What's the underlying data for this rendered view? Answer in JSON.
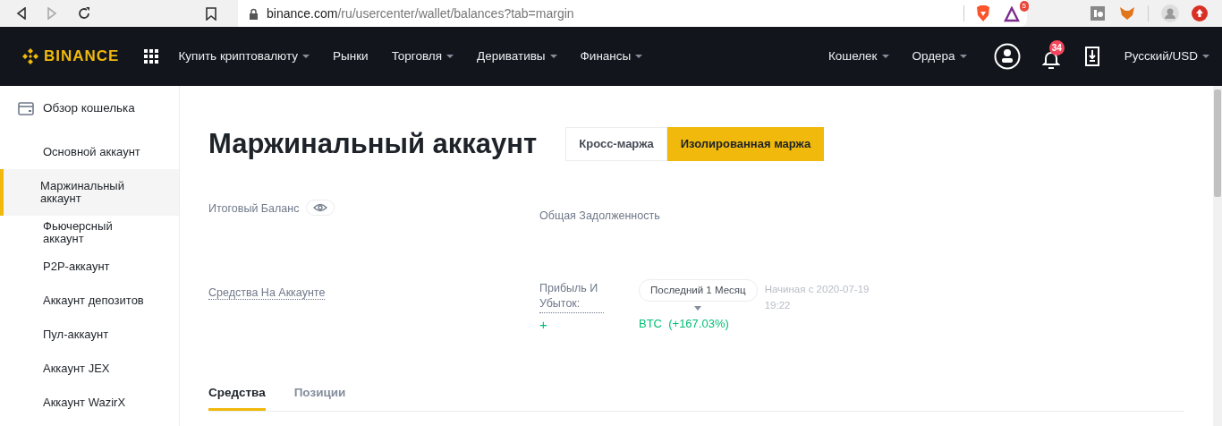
{
  "browser": {
    "url_host": "binance.com",
    "url_path": "/ru/usercenter/wallet/balances?tab=margin",
    "extension_badge": "5"
  },
  "nav": {
    "logo": "BINANCE",
    "menu": [
      {
        "label": "Купить криптовалюту",
        "dropdown": true
      },
      {
        "label": "Рынки",
        "dropdown": false
      },
      {
        "label": "Торговля",
        "dropdown": true
      },
      {
        "label": "Деривативы",
        "dropdown": true
      },
      {
        "label": "Финансы",
        "dropdown": true
      }
    ],
    "right_menu": [
      {
        "label": "Кошелек",
        "dropdown": true
      },
      {
        "label": "Ордера",
        "dropdown": true
      }
    ],
    "notification_count": "34",
    "language": "Русский/USD"
  },
  "sidebar": {
    "header": "Обзор кошелька",
    "items": [
      {
        "label": "Основной аккаунт",
        "selected": false
      },
      {
        "label": "Маржинальный аккаунт",
        "selected": true
      },
      {
        "label": "Фьючерсный аккаунт",
        "selected": false
      },
      {
        "label": "P2P-аккаунт",
        "selected": false
      },
      {
        "label": "Аккаунт депозитов",
        "selected": false
      },
      {
        "label": "Пул-аккаунт",
        "selected": false
      },
      {
        "label": "Аккаунт JEX",
        "selected": false
      },
      {
        "label": "Аккаунт WazirX",
        "selected": false
      }
    ]
  },
  "page": {
    "title": "Маржинальный аккаунт",
    "mode_toggle": [
      {
        "label": "Кросс-маржа",
        "selected": false
      },
      {
        "label": "Изолированная маржа",
        "selected": true
      }
    ],
    "total_balance_label": "Итоговый Баланс",
    "total_debt_label": "Общая Задолженность",
    "account_funds_label": "Средства На Аккаунте",
    "pnl_label": "Прибыль И Убыток:",
    "period": "Последний 1 Месяц",
    "start_info": "Начиная с 2020-07-19 19:22",
    "pnl_sign": "+",
    "pnl_asset": "BTC",
    "pnl_percent": "(+167.03%)",
    "tabs": [
      {
        "label": "Средства",
        "selected": true
      },
      {
        "label": "Позиции",
        "selected": false
      }
    ]
  }
}
